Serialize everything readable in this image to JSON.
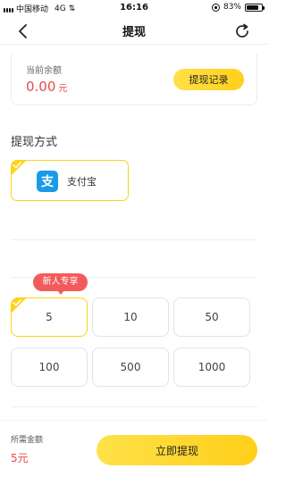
{
  "status_bar": {
    "carrier": "中国移动",
    "network": "4G",
    "time": "16:16",
    "battery": "83%",
    "battery_level": 0.83
  },
  "nav": {
    "title": "提现",
    "back_icon": "chevron-left-icon",
    "refresh_icon": "refresh-icon"
  },
  "balance": {
    "label": "当前余额",
    "amount": "0.00",
    "unit": "元",
    "history_button": "提现记录"
  },
  "method_section": {
    "title": "提现方式",
    "methods": [
      {
        "name": "支付宝",
        "icon": "alipay-icon",
        "icon_glyph": "支",
        "selected": true
      }
    ]
  },
  "amounts": {
    "badge": "新人专享",
    "options": [
      {
        "label": "5",
        "selected": true
      },
      {
        "label": "10",
        "selected": false
      },
      {
        "label": "50",
        "selected": false
      },
      {
        "label": "100",
        "selected": false
      },
      {
        "label": "500",
        "selected": false
      },
      {
        "label": "1000",
        "selected": false
      }
    ]
  },
  "footer": {
    "required_label": "所需金额",
    "required_value": "5元",
    "submit_button": "立即提现"
  },
  "colors": {
    "accent_yellow": "#ffd21a",
    "price_red": "#e94a4a",
    "badge_red": "#f35b5b",
    "alipay_blue": "#1a9be6"
  }
}
